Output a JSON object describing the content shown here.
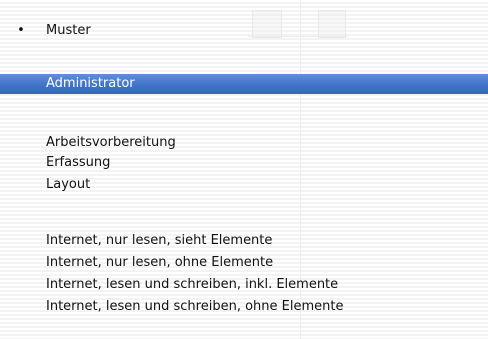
{
  "menu": {
    "items": [
      {
        "label": "Muster",
        "checked": true,
        "bullet": "•"
      },
      {
        "label": "Administrator",
        "selected": true
      },
      {
        "label": "Arbeitsvorbereitung"
      },
      {
        "label": "Erfassung"
      },
      {
        "label": "Layout"
      },
      {
        "label": "Internet, nur lesen, sieht Elemente"
      },
      {
        "label": "Internet, nur lesen, ohne Elemente"
      },
      {
        "label": "Internet, lesen und schreiben, inkl. Elemente"
      },
      {
        "label": "Internet, lesen und schreiben, ohne Elemente"
      }
    ]
  },
  "colors": {
    "selection_highlight": "#3f72c8",
    "selected_text": "#ffffff",
    "text": "#111111"
  }
}
